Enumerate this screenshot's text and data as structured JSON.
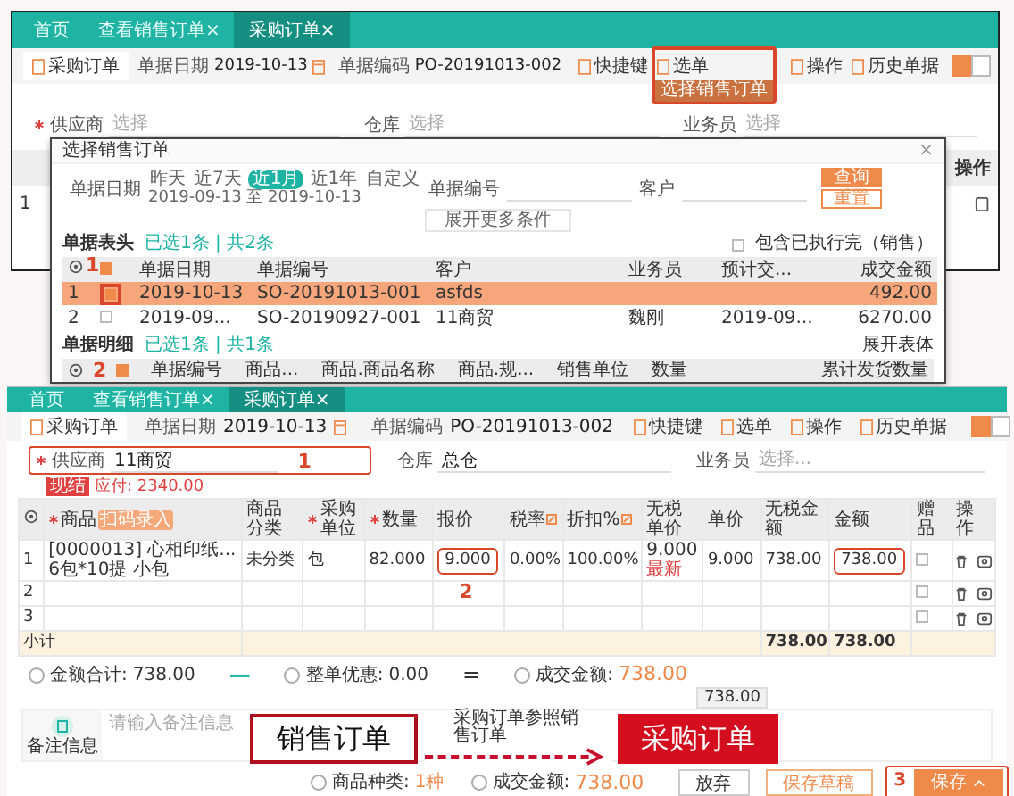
{
  "top_window": {
    "tabs": [
      {
        "label": "首页",
        "selected": false
      },
      {
        "label": "查看销售订单",
        "close": "×",
        "selected": false
      },
      {
        "label": "采购订单",
        "close": "×",
        "selected": true
      }
    ],
    "title": "采购订单",
    "date_label": "单据日期",
    "date": "2019-10-13",
    "code_label": "单据编码",
    "code": "PO-20191013-002",
    "toolbar": [
      {
        "label": "快捷键",
        "highlighted": false
      },
      {
        "label": "选单",
        "highlighted": true
      },
      {
        "label": "操作",
        "highlighted": false
      },
      {
        "label": "历史单据",
        "highlighted": false
      }
    ],
    "toolbar_menu": "选择销售订单",
    "view_modes": [
      {
        "selected": true
      },
      {
        "selected": false
      }
    ],
    "fields": [
      {
        "label": "供应商",
        "required": true,
        "placeholder": "选择"
      },
      {
        "label": "仓库",
        "required": false,
        "placeholder": "选择"
      },
      {
        "label": "业务员",
        "required": false,
        "placeholder": "选择"
      }
    ],
    "table": {
      "last_column": "操作",
      "rows": [
        {
          "number": "1"
        }
      ]
    }
  },
  "dialog": {
    "title": "选择销售订单",
    "close": "×",
    "date_label": "单据日期",
    "date_options": [
      {
        "label": "昨天",
        "selected": false
      },
      {
        "label": "近7天",
        "selected": false
      },
      {
        "label": "近1月",
        "selected": true
      },
      {
        "label": "近1年",
        "selected": false
      },
      {
        "label": "自定义",
        "selected": false
      }
    ],
    "date_range": "2019-09-13 至 2019-10-13",
    "code_label": "单据编号",
    "customer_label": "客户",
    "more": "展开更多条件",
    "search_button": "查询",
    "reset_button": "重置",
    "header_section": {
      "title": "单据表头",
      "selection": "已选1条 | 共2条",
      "include_done": {
        "label": "包含已执行完（销售）",
        "checked": false
      },
      "marker": "1",
      "all_checked": true,
      "columns": [
        "单据日期",
        "单据编号",
        "客户",
        "业务员",
        "预计交...",
        "成交金额"
      ],
      "rows": [
        {
          "number": "1",
          "selected": true,
          "checked": true,
          "date": "2019-10-13",
          "code": "SO-20191013-001",
          "customer": "asfds",
          "amount": "492.00"
        },
        {
          "number": "2",
          "selected": false,
          "checked": false,
          "date": "2019-09...",
          "code": "SO-20190927-001",
          "customer": "11商贸",
          "salesperson": "魏刚",
          "delivery": "2019-09...",
          "amount": "6270.00"
        }
      ]
    },
    "detail_section": {
      "title": "单据明细",
      "selection": "已选1条 | 共1条",
      "expand": "展开表体",
      "marker": "2",
      "checked": true,
      "columns": [
        "单据编号",
        "商品...",
        "商品.商品名称",
        "商品.规...",
        "销售单位",
        "数量"
      ],
      "last_column": "累计发货数量"
    }
  },
  "bottom_window": {
    "tabs": [
      {
        "label": "首页",
        "selected": false
      },
      {
        "label": "查看销售订单",
        "close": "×",
        "selected": false
      },
      {
        "label": "采购订单",
        "close": "×",
        "selected": true
      }
    ],
    "title": "采购订单",
    "date_label": "单据日期",
    "date": "2019-10-13",
    "code_label": "单据编码",
    "code": "PO-20191013-002",
    "toolbar": [
      {
        "label": "快捷键"
      },
      {
        "label": "选单"
      },
      {
        "label": "操作"
      },
      {
        "label": "历史单据"
      }
    ],
    "view_modes": [
      {
        "selected": true
      },
      {
        "selected": false
      }
    ],
    "supplier": {
      "label": "供应商",
      "required": true,
      "value": "11商贸",
      "marker": "1"
    },
    "fields": [
      {
        "label": "仓库",
        "value": "总仓"
      },
      {
        "label": "业务员",
        "placeholder": "选择..."
      }
    ],
    "settlement": {
      "badge": "现结",
      "payable": "应付: 2340.00"
    },
    "columns": [
      {
        "label": "商品",
        "required": true,
        "badge": "扫码录入"
      },
      {
        "label": "商品分类"
      },
      {
        "label": "采购单位",
        "required": true
      },
      {
        "label": "数量",
        "required": true
      },
      {
        "label": "报价"
      },
      {
        "label": "税率",
        "editable": true
      },
      {
        "label": "折扣%",
        "editable": true
      },
      {
        "label": "无税单价"
      },
      {
        "label": "单价"
      },
      {
        "label": "无税金额"
      },
      {
        "label": "金额"
      },
      {
        "label": "赠品"
      },
      {
        "label": "操作"
      }
    ],
    "rows": [
      {
        "number": "1",
        "product": "[0000013] 心相印纸...",
        "spec": "6包*10提 小包",
        "category": "未分类",
        "unit": "包",
        "quantity": "82.000",
        "quote": "9.000",
        "tax_rate": "0.00%",
        "discount": "100.00%",
        "net_price": "9.000",
        "price_tag": "最新",
        "price": "9.000",
        "net_amount": "738.00",
        "amount": "738.00",
        "gift": false
      },
      {
        "number": "2",
        "gift": false
      },
      {
        "number": "3",
        "gift": false
      }
    ],
    "highlight_marker": "2",
    "subtotal": {
      "label": "小计",
      "net_amount": "738.00",
      "amount": "738.00"
    },
    "totals": {
      "sum_label": "金额合计:",
      "sum": "738.00",
      "minus": "—",
      "discount_label": "整单优惠:",
      "discount": "0.00",
      "equals": "=",
      "final_label": "成交金额:",
      "final": "738.00",
      "tooltip": "738.00"
    },
    "note": {
      "label": "备注信息",
      "placeholder": "请输入备注信息"
    },
    "footer": {
      "kinds_label": "商品种类:",
      "kinds": "1种",
      "amount_label": "成交金额:",
      "amount": "738.00",
      "marker": "3",
      "buttons": [
        {
          "label": "放弃",
          "kind": "plain"
        },
        {
          "label": "保存草稿",
          "kind": "outline"
        },
        {
          "label": "保存",
          "kind": "primary"
        }
      ]
    }
  },
  "overlay": {
    "source": "销售订单",
    "relation": "采购订单参照销售订单",
    "target": "采购订单"
  }
}
